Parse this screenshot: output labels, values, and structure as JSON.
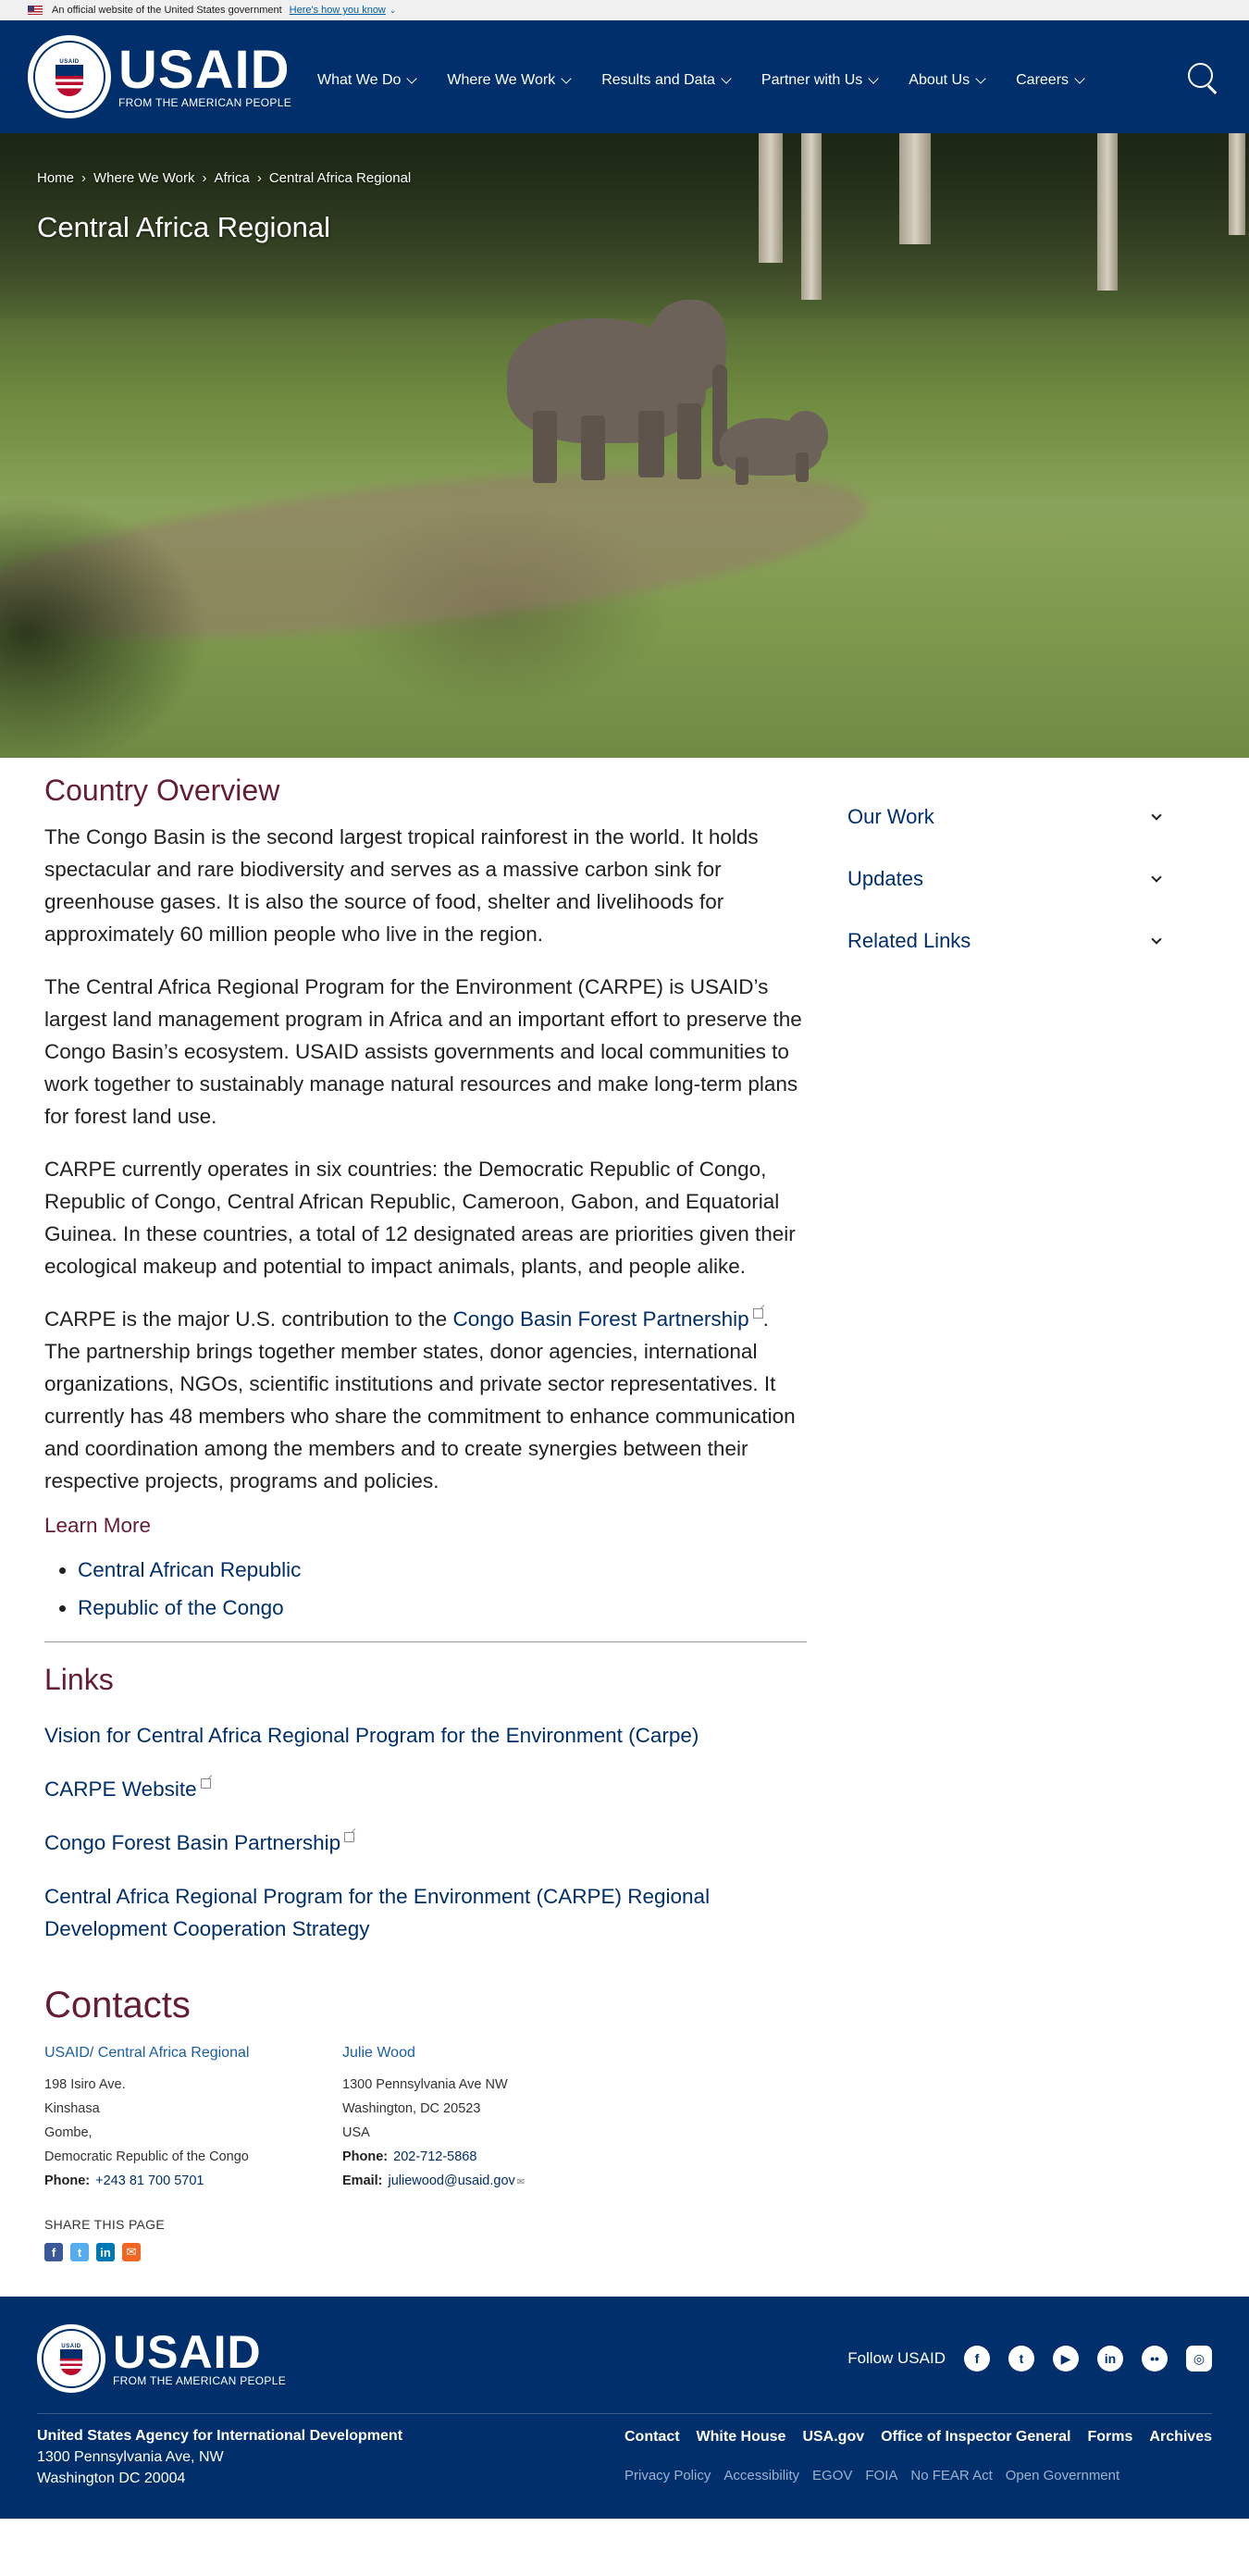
{
  "gov_banner": {
    "text": "An official website of the United States government",
    "how_link": "Here's how you know"
  },
  "header": {
    "logo_text": "USAID",
    "tagline": "FROM THE AMERICAN PEOPLE",
    "seal_text": "USAID",
    "nav": [
      "What We Do",
      "Where We Work",
      "Results and Data",
      "Partner with Us",
      "About Us",
      "Careers"
    ]
  },
  "breadcrumb": [
    "Home",
    "Where We Work",
    "Africa",
    "Central Africa Regional"
  ],
  "page_title": "Central Africa Regional",
  "overview": {
    "title": "Country Overview",
    "p1": "The Congo Basin is the second largest tropical rainforest in the world.  It holds spectacular and rare biodiversity and serves as a massive carbon sink for greenhouse gases. It is also the source of food, shelter and livelihoods for approximately 60 million people who live in the region.",
    "p2": "The Central Africa Regional Program for the Environment (CARPE) is USAID’s largest land management program in Africa and an important effort to preserve the Congo Basin’s ecosystem. USAID assists governments and local communities to work together to sustainably manage natural resources and make long-term plans for forest land use.",
    "p3": "CARPE currently operates in six countries: the Democratic Republic of Congo, Republic of Congo, Central African Republic, Cameroon, Gabon, and Equatorial Guinea. In these countries, a total of 12 designated areas are priorities given their ecological makeup and potential to impact animals, plants, and people alike.",
    "p4_pre": "CARPE is the major U.S. contribution to the ",
    "p4_link": "Congo Basin Forest Partnership",
    "p4_post": ". The partnership brings together member states, donor agencies, international organizations, NGOs, scientific institutions and private sector representatives. It currently has 48 members who share the commitment to enhance communication and coordination among the members and to create synergies between their respective projects, programs and policies.",
    "learn_more": "Learn More",
    "learn_links": [
      "Central African Republic",
      "Republic of the Congo"
    ]
  },
  "links": {
    "title": "Links",
    "items": [
      "Vision for Central Africa Regional Program for the Environment (Carpe)",
      "CARPE Website",
      "Congo Forest Basin Partnership",
      "Central Africa Regional Program for the Environment (CARPE) Regional Development Cooperation Strategy"
    ]
  },
  "sidebar": [
    "Our Work",
    "Updates",
    "Related Links"
  ],
  "contacts": {
    "title": "Contacts",
    "c1": {
      "name": "USAID/ Central Africa Regional",
      "lines": [
        "198 Isiro Ave.",
        "Kinshasa",
        "Gombe,",
        "Democratic Republic of the Congo"
      ],
      "phone_label": "Phone:",
      "phone": "+243 81 700 5701"
    },
    "c2": {
      "name": "Julie Wood",
      "lines": [
        "1300 Pennsylvania Ave NW",
        "Washington, DC 20523",
        "USA"
      ],
      "phone_label": "Phone:",
      "phone": "202-712-5868",
      "email_label": "Email:",
      "email": "juliewood@usaid.gov"
    },
    "share": "SHARE THIS PAGE"
  },
  "footer": {
    "logo_text": "USAID",
    "tagline": "FROM THE AMERICAN PEOPLE",
    "follow": "Follow USAID",
    "org": "United States Agency for International Development",
    "addr1": "1300 Pennsylvania Ave, NW",
    "addr2": "Washington DC 20004",
    "links": [
      "Contact",
      "White House",
      "USA.gov",
      "Office of Inspector General",
      "Forms",
      "Archives"
    ],
    "small_links": [
      "Privacy Policy",
      "Accessibility",
      "EGOV",
      "FOIA",
      "No FEAR Act",
      "Open Government"
    ]
  }
}
